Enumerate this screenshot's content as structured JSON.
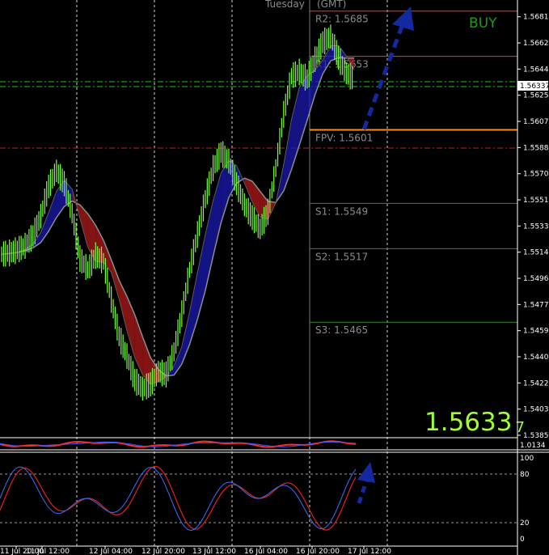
{
  "header": {
    "day": "Tuesday",
    "tz": "(GMT)"
  },
  "signal": {
    "text": "BUY",
    "color": "#1e9a1e"
  },
  "big_price": {
    "main": "1.5633",
    "sub": "7",
    "color": "#9dff2f"
  },
  "current_price": "1.56337",
  "pivots": [
    {
      "label": "R2:  1.5685",
      "value": 1.5685,
      "color": "#ff3030"
    },
    {
      "label": "R1:  1.5653",
      "value": 1.5653,
      "color": "#ff3030"
    },
    {
      "label": "FPV:  1.5601",
      "value": 1.5601,
      "color": "#ff8c1a"
    },
    {
      "label": "S1:  1.5549",
      "value": 1.5549,
      "color": "#2e8b2e"
    },
    {
      "label": "S2:  1.5517",
      "value": 1.5517,
      "color": "#2e8b2e"
    },
    {
      "label": "S3:  1.5465",
      "value": 1.5465,
      "color": "#2e8b2e"
    }
  ],
  "price_axis": [
    "1.56810",
    "1.56625",
    "1.56440",
    "1.56255",
    "1.56070",
    "1.55885",
    "1.55700",
    "1.55515",
    "1.55330",
    "1.55145",
    "1.54960",
    "1.54775",
    "1.54590",
    "1.54405",
    "1.54220",
    "1.54035",
    "1.53850"
  ],
  "time_axis": [
    "11 Jul 20:00",
    "11 Jul 12:00",
    "12 Jul 04:00",
    "12 Jul 20:00",
    "13 Jul 12:00",
    "16 Jul 04:00",
    "16 Jul 20:00",
    "17 Jul 12:00"
  ],
  "osc_axis": [
    "100",
    "80",
    "20",
    "0"
  ],
  "mini_axis": [
    "1.0134"
  ],
  "chart_data": {
    "type": "line",
    "ylim": [
      1.5385,
      1.569
    ],
    "title": "",
    "series": [
      {
        "name": "",
        "values": [
          1.5513,
          1.5514,
          1.5516,
          1.5519,
          1.5526,
          1.554,
          1.5561,
          1.5572,
          1.5563,
          1.5542,
          1.551,
          1.5502,
          1.5512,
          1.5508,
          1.5481,
          1.5455,
          1.5441,
          1.5424,
          1.5418,
          1.5421,
          1.543,
          1.5428,
          1.5444,
          1.5471,
          1.5502,
          1.5527,
          1.5552,
          1.5574,
          1.5585,
          1.5579,
          1.5563,
          1.5548,
          1.5539,
          1.5531,
          1.5543,
          1.5574,
          1.5612,
          1.5639,
          1.5642,
          1.5637,
          1.5651,
          1.5663,
          1.5667,
          1.5652,
          1.5641,
          1.5637
        ]
      }
    ]
  }
}
